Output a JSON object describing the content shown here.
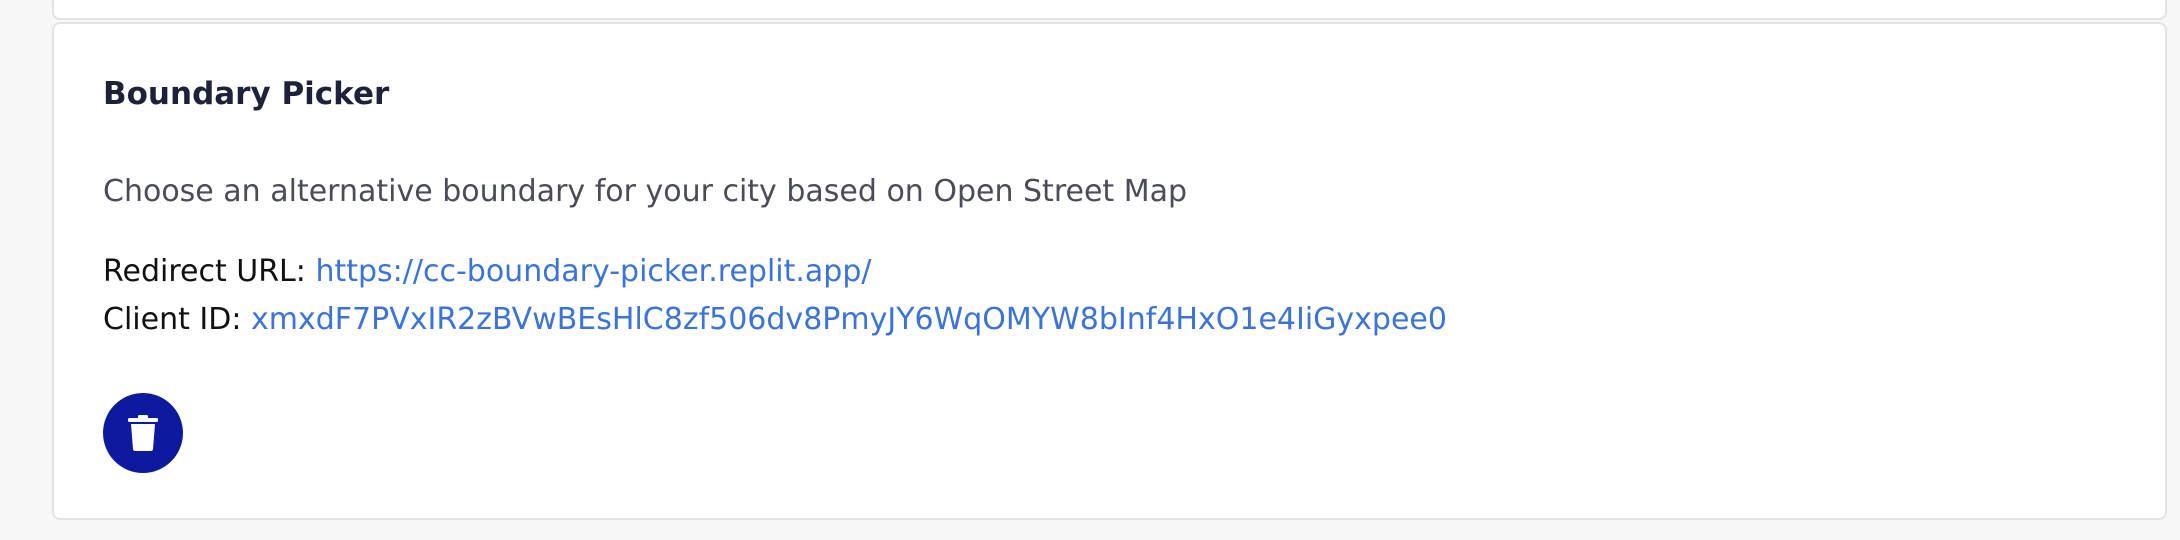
{
  "card": {
    "title": "Boundary Picker",
    "description": "Choose an alternative boundary for your city based on Open Street Map",
    "redirect_label": "Redirect URL:",
    "redirect_url": "https://cc-boundary-picker.replit.app/",
    "client_label": "Client ID:",
    "client_id": "xmxdF7PVxIR2zBVwBEsHlC8zf506dv8PmyJY6WqOMYW8bInf4HxO1e4IiGyxpee0",
    "delete_icon": "trash-icon"
  },
  "colors": {
    "title": "#1e2238",
    "description": "#4a4d57",
    "link": "#3b73d9",
    "delete_button": "#0d1aa0",
    "card_border": "#e2e3e6",
    "background": "#f7f7f8"
  }
}
